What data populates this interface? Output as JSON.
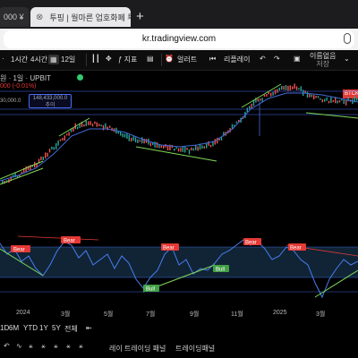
{
  "browser": {
    "tabs": [
      {
        "label": "000 ¥"
      },
      {
        "label": "투핑 | 월마른 업호화폐 투자"
      }
    ],
    "new_tab": "+",
    "url": "kr.tradingview.com"
  },
  "toolbar": {
    "intervals": [
      "1시간",
      "4시간"
    ],
    "interval_selected": "12일",
    "indicator": "지표",
    "alert": "얼러트",
    "replay": "리플레이",
    "layout_name": "이름없음",
    "layout_state": "저장"
  },
  "symbol": {
    "title": "원 · 1일 · UPBIT",
    "change": "000 (-0.01%)",
    "price_box": "148,433,000.0",
    "price_box_sub": "추이",
    "level": "30,000.0",
    "tag": "BTCK"
  },
  "signals": {
    "bear": "Bear",
    "bull": "Bull"
  },
  "timeline": {
    "labels": [
      "2024",
      "3월",
      "5월",
      "7월",
      "9월",
      "11월",
      "2025",
      "3월"
    ]
  },
  "ranges": [
    "1D",
    "6M",
    "YTD",
    "1Y",
    "5Y",
    "전체"
  ],
  "bottom_tools": [
    "레이 트레이딩 패널",
    "트레이딩패널"
  ],
  "colors": {
    "background": "#000000",
    "bear_label": "#e53935",
    "bull_label": "#43a047",
    "trendline": "#7ed957",
    "ma": "#3f6bd8",
    "band": "#1a3a5a"
  }
}
